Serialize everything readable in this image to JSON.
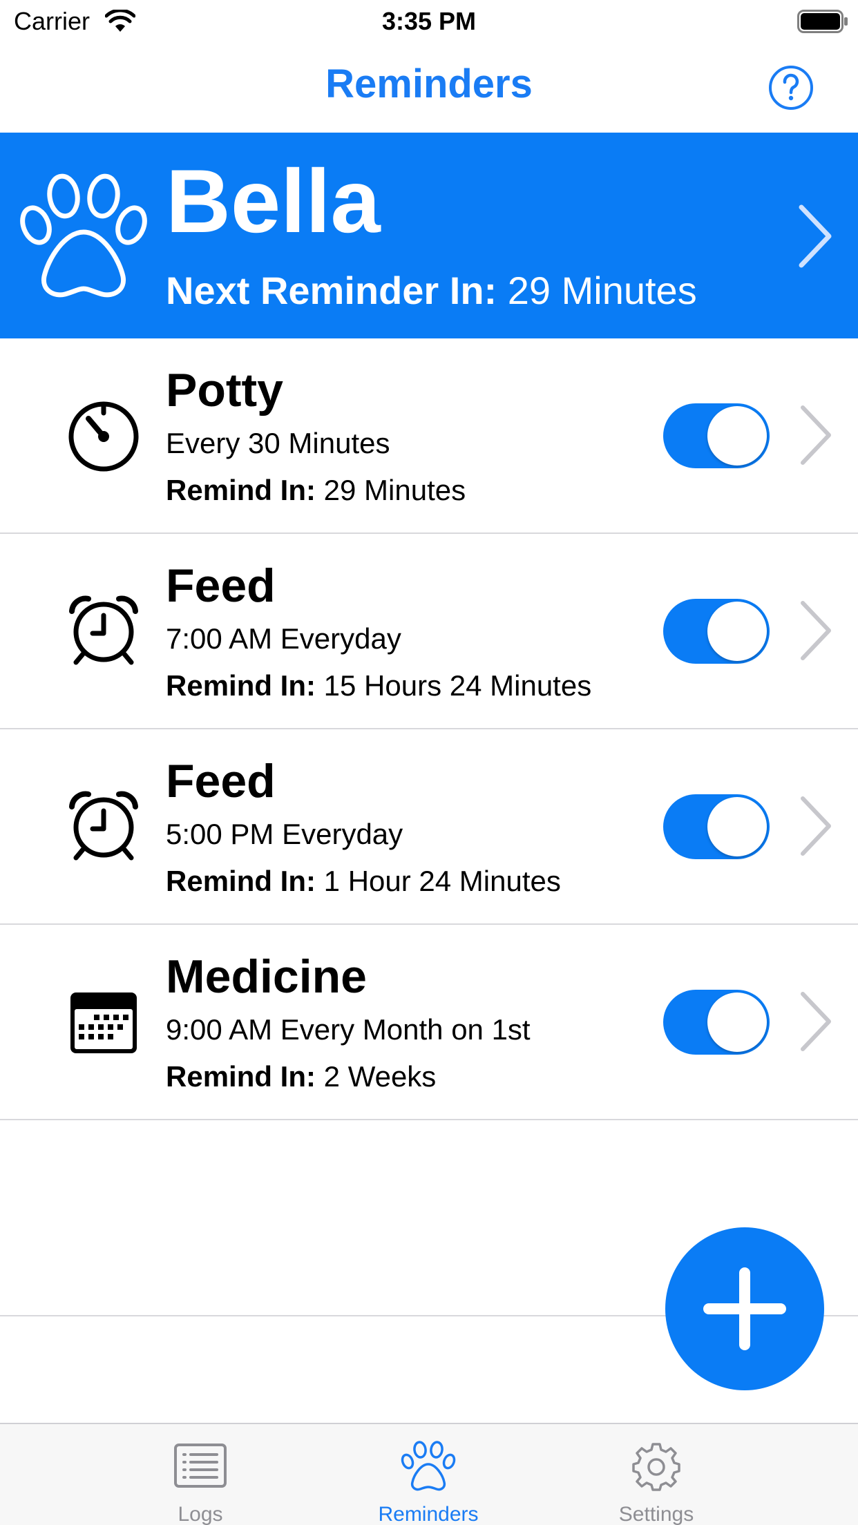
{
  "status_bar": {
    "carrier": "Carrier",
    "time": "3:35 PM"
  },
  "nav": {
    "title": "Reminders"
  },
  "dog": {
    "name": "Bella",
    "next_label": "Next Reminder In:",
    "next_value": "29 Minutes"
  },
  "reminders": [
    {
      "title": "Potty",
      "schedule": "Every 30 Minutes",
      "remind_label": "Remind In:",
      "remind_value": "29 Minutes",
      "icon": "timer-icon",
      "enabled": true
    },
    {
      "title": "Feed",
      "schedule": "7:00 AM Everyday",
      "remind_label": "Remind In:",
      "remind_value": "15 Hours 24 Minutes",
      "icon": "alarm-clock-icon",
      "enabled": true
    },
    {
      "title": "Feed",
      "schedule": "5:00 PM Everyday",
      "remind_label": "Remind In:",
      "remind_value": "1 Hour 24 Minutes",
      "icon": "alarm-clock-icon",
      "enabled": true
    },
    {
      "title": "Medicine",
      "schedule": "9:00 AM Every Month on 1st",
      "remind_label": "Remind In:",
      "remind_value": "2 Weeks",
      "icon": "calendar-icon",
      "enabled": true
    }
  ],
  "tabs": [
    {
      "label": "Logs",
      "icon": "list-icon",
      "active": false
    },
    {
      "label": "Reminders",
      "icon": "paw-icon",
      "active": true
    },
    {
      "label": "Settings",
      "icon": "gear-icon",
      "active": false
    }
  ],
  "colors": {
    "accent": "#0a7cf5",
    "inactive": "#8e8e93"
  }
}
